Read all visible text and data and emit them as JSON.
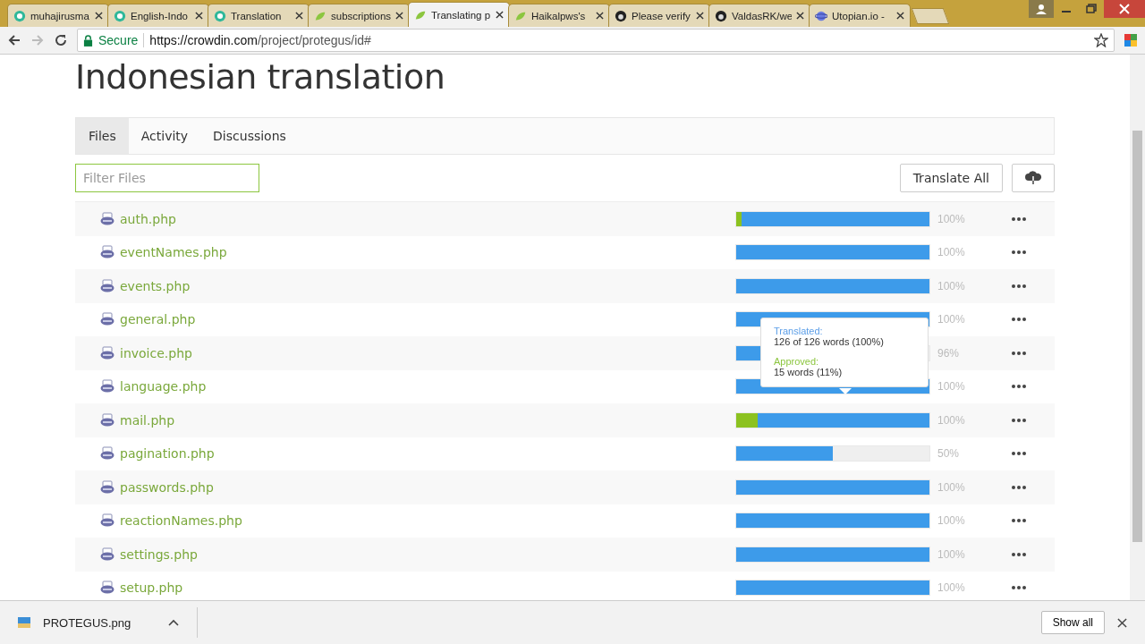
{
  "browser": {
    "tabs": [
      {
        "title": "muhajirusma",
        "selected": false
      },
      {
        "title": "English-Indo",
        "selected": false
      },
      {
        "title": "Translation",
        "selected": false
      },
      {
        "title": "subscriptions",
        "selected": false
      },
      {
        "title": "Translating p",
        "selected": true
      },
      {
        "title": "Haikalpws's",
        "selected": false
      },
      {
        "title": "Please verify",
        "selected": false
      },
      {
        "title": "ValdasRK/we",
        "selected": false
      },
      {
        "title": "Utopian.io -",
        "selected": false
      }
    ],
    "secure_label": "Secure",
    "url_host": "https://crowdin.com",
    "url_path": "/project/protegus/id#"
  },
  "page": {
    "title": "Indonesian translation",
    "tabs": [
      {
        "label": "Files",
        "selected": true
      },
      {
        "label": "Activity",
        "selected": false
      },
      {
        "label": "Discussions",
        "selected": false
      }
    ],
    "filter": {
      "placeholder": "Filter Files"
    },
    "translate_all": "Translate All",
    "files": [
      {
        "name": "auth.php",
        "translated": {
          "level": 1
        },
        "approved": {
          "level": 0.03
        },
        "percent": "100%"
      },
      {
        "name": "eventNames.php",
        "translated": {
          "level": 1
        },
        "percent": "100%"
      },
      {
        "name": "events.php",
        "translated": {
          "level": 1
        },
        "percent": "100%"
      },
      {
        "name": "general.php",
        "translated": {
          "level": 1
        },
        "percent": "100%"
      },
      {
        "name": "invoice.php",
        "translated": {
          "level": 0.96
        },
        "percent": "96%"
      },
      {
        "name": "language.php",
        "translated": {
          "level": 1
        },
        "percent": "100%"
      },
      {
        "name": "mail.php",
        "translated": {
          "level": 1
        },
        "approved": {
          "level": 0.11
        },
        "percent": "100%"
      },
      {
        "name": "pagination.php",
        "translated": {
          "level": 0.5
        },
        "percent": "50%"
      },
      {
        "name": "passwords.php",
        "translated": {
          "level": 1
        },
        "percent": "100%"
      },
      {
        "name": "reactionNames.php",
        "translated": {
          "level": 1
        },
        "percent": "100%"
      },
      {
        "name": "settings.php",
        "translated": {
          "level": 1
        },
        "percent": "100%"
      },
      {
        "name": "setup.php",
        "translated": {
          "level": 1
        },
        "percent": "100%"
      }
    ],
    "tooltip": {
      "translated_label": "Translated:",
      "translated_value": "126 of 126 words (100%)",
      "approved_label": "Approved:",
      "approved_value": "15 words (11%)"
    }
  },
  "download_bar": {
    "file": "PROTEGUS.png",
    "show_all": "Show all"
  }
}
